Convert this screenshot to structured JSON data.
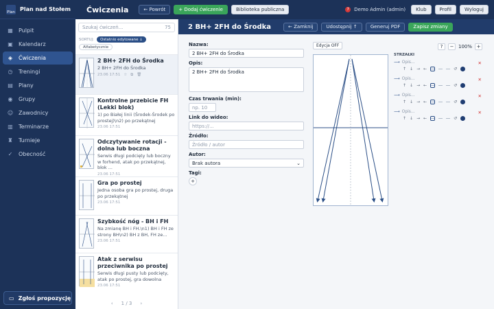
{
  "brand": {
    "name": "Plan nad Stołem",
    "logo_text": "Plan"
  },
  "nav": [
    {
      "label": "Pulpit",
      "icon": "grid-icon",
      "glyph": "▦"
    },
    {
      "label": "Kalendarz",
      "icon": "calendar-icon",
      "glyph": "▣"
    },
    {
      "label": "Ćwiczenia",
      "icon": "exercise-icon",
      "glyph": "◈",
      "active": true
    },
    {
      "label": "Treningi",
      "icon": "training-icon",
      "glyph": "◷"
    },
    {
      "label": "Plany",
      "icon": "plans-icon",
      "glyph": "▤"
    },
    {
      "label": "Grupy",
      "icon": "groups-icon",
      "glyph": "◉"
    },
    {
      "label": "Zawodnicy",
      "icon": "players-icon",
      "glyph": "☺"
    },
    {
      "label": "Terminarze",
      "icon": "schedule-icon",
      "glyph": "▥"
    },
    {
      "label": "Turnieje",
      "icon": "trophy-icon",
      "glyph": "♜"
    },
    {
      "label": "Obecność",
      "icon": "attendance-icon",
      "glyph": "✓"
    }
  ],
  "propose_label": "Zgłoś propozycję",
  "topbar": {
    "title": "Ćwiczenia",
    "back": "← Powrót",
    "add": "+ Dodaj ćwiczenie",
    "library": "Biblioteka publiczna",
    "notif_count": "7",
    "user": "Demo Admin (admin)",
    "club": "Klub",
    "profile": "Profil",
    "logout": "Wyloguj"
  },
  "list": {
    "search_placeholder": "Szukaj ćwiczeń...",
    "count": "75",
    "sort_label": "SORTUJ:",
    "sort_active": "Ostatnio edytowane ↓",
    "sort_alt": "Alfabetycznie",
    "pager": "1 / 3",
    "items": [
      {
        "title": "2 BH+ 2FH do Środka",
        "desc": "2 BH+ 2FH do Środka",
        "date": "23.06 17:51",
        "active": true
      },
      {
        "title": "Kontrolne przebicie FH (Lekki blok)",
        "desc": "1) po Białej linii (Środek-Środek po prostej)\\n2) po przekątnej",
        "date": "23.06 17:51"
      },
      {
        "title": "Odczytywanie rotacji - dolna lub boczna",
        "desc": "Serwis długi podcięty lub boczny w forhend, atak po przekątnej, blok ...",
        "date": "23.06 17:51"
      },
      {
        "title": "Gra po prostej",
        "desc": "Jedna osoba gra po prostej, druga po przekątnej",
        "date": "23.06 17:51"
      },
      {
        "title": "Szybkość nóg - BH i FH",
        "desc": "Na zmianę BH i FH.\\n1) BH i FH ze strony BH\\n2) BH z BH, FH ze...",
        "date": "23.06 17:51"
      },
      {
        "title": "Atak z serwisu przeciwnika po prostej",
        "desc": "Serwis długi pusty lub podcięty, atak po prostej, gra dowolna",
        "date": "23.06 17:51"
      }
    ]
  },
  "detail": {
    "title": "2 BH+ 2FH do Środka",
    "close": "← Zamknij",
    "share": "Udostępnij ↑",
    "pdf": "Generuj PDF",
    "save": "Zapisz zmiany",
    "name_label": "Nazwa:",
    "name_value": "2 BH+  2FH do Środka",
    "desc_label": "Opis:",
    "desc_value": "2 BH+  2FH do Środka",
    "duration_label": "Czas trwania (min):",
    "duration_placeholder": "np. 10",
    "video_label": "Link do wideo:",
    "video_placeholder": "https://...",
    "source_label": "Źródło:",
    "source_placeholder": "Źródło / autor",
    "author_label": "Autor:",
    "author_value": "Brak autora",
    "tags_label": "Tagi:",
    "edit_mode": "Edycja OFF",
    "help": "?",
    "zoom_minus": "−",
    "zoom_value": "100%",
    "zoom_plus": "+",
    "arrows_header": "STRZAŁKI",
    "arrows": [
      {
        "label": "Opis..."
      },
      {
        "label": "Opis..."
      },
      {
        "label": "Opis..."
      },
      {
        "label": "Opis..."
      }
    ]
  }
}
